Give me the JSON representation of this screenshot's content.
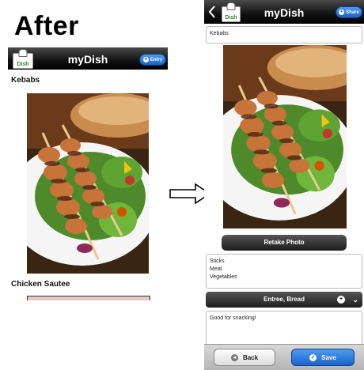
{
  "heading": "After",
  "left_screen": {
    "app_title": "myDish",
    "logo_text": "Dish",
    "entry_button": "Entry",
    "items": [
      {
        "name": "Kebabs"
      },
      {
        "name": "Chicken Sautee"
      }
    ]
  },
  "right_screen": {
    "app_title": "myDish",
    "logo_text": "Dish",
    "share_button": "Share",
    "dish_name_value": "Kebabs",
    "retake_photo_label": "Retake Photo",
    "ingredients_lines": [
      "Sticks",
      "Meat",
      "Vegetables"
    ],
    "category_value": "Entree, Bread",
    "notes_value": "Good for snacking!",
    "back_button": "Back",
    "save_button": "Save"
  },
  "colors": {
    "bar_dark": "#111111",
    "button_blue": "#1b63c9",
    "logo_green": "#2e7d32"
  }
}
